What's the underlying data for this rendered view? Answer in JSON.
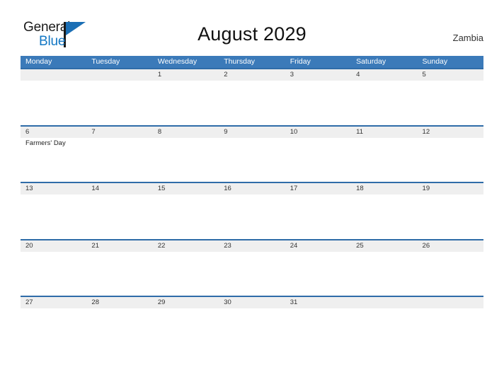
{
  "brand": {
    "name_part1": "General",
    "name_part2": "Blue",
    "flag_color": "#1b6fb5"
  },
  "header": {
    "title": "August 2029",
    "country": "Zambia"
  },
  "theme": {
    "header_blue": "#3b7ab9",
    "row_border_blue": "#2f6ca8",
    "band_gray": "#efefef",
    "page_background": "#ffffff"
  },
  "calendar": {
    "weekdays": [
      "Monday",
      "Tuesday",
      "Wednesday",
      "Thursday",
      "Friday",
      "Saturday",
      "Sunday"
    ],
    "weeks": [
      {
        "days": [
          {
            "num": "",
            "event": ""
          },
          {
            "num": "",
            "event": ""
          },
          {
            "num": "1",
            "event": ""
          },
          {
            "num": "2",
            "event": ""
          },
          {
            "num": "3",
            "event": ""
          },
          {
            "num": "4",
            "event": ""
          },
          {
            "num": "5",
            "event": ""
          }
        ]
      },
      {
        "days": [
          {
            "num": "6",
            "event": "Farmers' Day"
          },
          {
            "num": "7",
            "event": ""
          },
          {
            "num": "8",
            "event": ""
          },
          {
            "num": "9",
            "event": ""
          },
          {
            "num": "10",
            "event": ""
          },
          {
            "num": "11",
            "event": ""
          },
          {
            "num": "12",
            "event": ""
          }
        ]
      },
      {
        "days": [
          {
            "num": "13",
            "event": ""
          },
          {
            "num": "14",
            "event": ""
          },
          {
            "num": "15",
            "event": ""
          },
          {
            "num": "16",
            "event": ""
          },
          {
            "num": "17",
            "event": ""
          },
          {
            "num": "18",
            "event": ""
          },
          {
            "num": "19",
            "event": ""
          }
        ]
      },
      {
        "days": [
          {
            "num": "20",
            "event": ""
          },
          {
            "num": "21",
            "event": ""
          },
          {
            "num": "22",
            "event": ""
          },
          {
            "num": "23",
            "event": ""
          },
          {
            "num": "24",
            "event": ""
          },
          {
            "num": "25",
            "event": ""
          },
          {
            "num": "26",
            "event": ""
          }
        ]
      },
      {
        "days": [
          {
            "num": "27",
            "event": ""
          },
          {
            "num": "28",
            "event": ""
          },
          {
            "num": "29",
            "event": ""
          },
          {
            "num": "30",
            "event": ""
          },
          {
            "num": "31",
            "event": ""
          },
          {
            "num": "",
            "event": ""
          },
          {
            "num": "",
            "event": ""
          }
        ]
      }
    ]
  }
}
